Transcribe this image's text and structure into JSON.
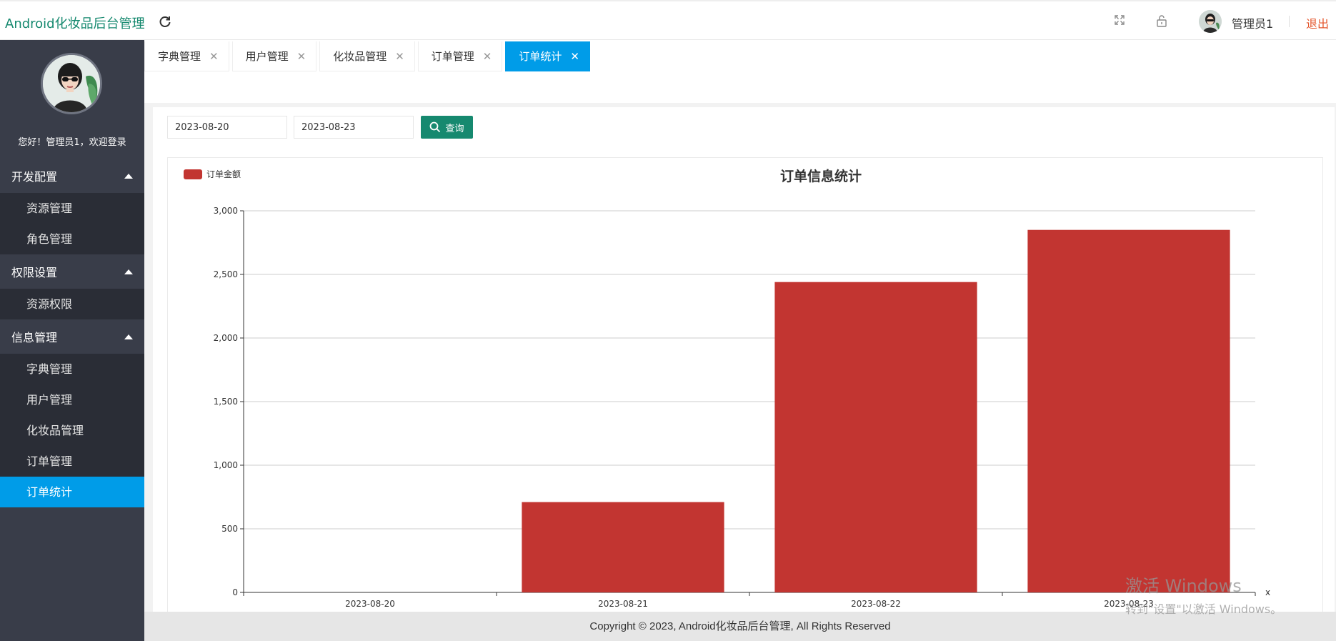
{
  "header": {
    "app_title": "Android化妆品后台管理",
    "username": "管理员1",
    "logout_label": "退出"
  },
  "sidebar": {
    "welcome": "您好！管理员1，欢迎登录",
    "groups": [
      {
        "label": "开发配置",
        "items": [
          "资源管理",
          "角色管理"
        ]
      },
      {
        "label": "权限设置",
        "items": [
          "资源权限"
        ]
      },
      {
        "label": "信息管理",
        "items": [
          "字典管理",
          "用户管理",
          "化妆品管理",
          "订单管理",
          "订单统计"
        ]
      }
    ],
    "active_item": "订单统计"
  },
  "tabs": [
    {
      "label": "字典管理",
      "active": false
    },
    {
      "label": "用户管理",
      "active": false
    },
    {
      "label": "化妆品管理",
      "active": false
    },
    {
      "label": "订单管理",
      "active": false
    },
    {
      "label": "订单统计",
      "active": true
    }
  ],
  "filters": {
    "start_date": "2023-08-20",
    "end_date": "2023-08-23",
    "search_label": "查询"
  },
  "chart_data": {
    "type": "bar",
    "title": "订单信息统计",
    "legend": [
      "订单金额"
    ],
    "legend_position": "top-left",
    "categories": [
      "2023-08-20",
      "2023-08-21",
      "2023-08-22",
      "2023-08-23"
    ],
    "series": [
      {
        "name": "订单金额",
        "values": [
          0,
          710,
          2440,
          2850
        ],
        "color": "#c23531"
      }
    ],
    "xlabel": "x",
    "ylabel": "",
    "ylim": [
      0,
      3000
    ],
    "yticks": [
      0,
      500,
      1000,
      1500,
      2000,
      2500,
      3000
    ],
    "ytick_labels": [
      "0",
      "500",
      "1,000",
      "1,500",
      "2,000",
      "2,500",
      "3,000"
    ],
    "grid": true
  },
  "footer": {
    "copyright": "Copyright © 2023, Android化妆品后台管理, All Rights Reserved"
  },
  "watermark": {
    "line1": "激活 Windows",
    "line2": "转到\"设置\"以激活 Windows。"
  },
  "colors": {
    "brand": "#16896f",
    "accent": "#009ce8",
    "bar": "#c23531",
    "logout": "#e4572e"
  }
}
